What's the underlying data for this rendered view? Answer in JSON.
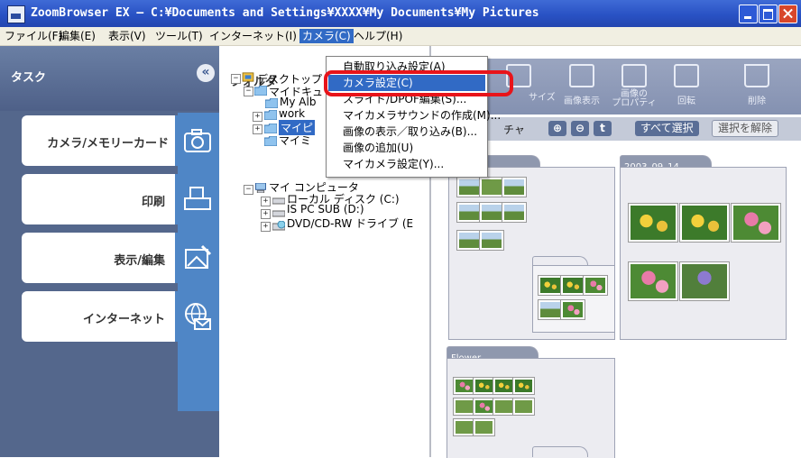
{
  "window": {
    "title": "ZoomBrowser EX  –  C:¥Documents and Settings¥XXXX¥My Documents¥My Pictures"
  },
  "menubar": {
    "items": [
      "ファイル(F)",
      "編集(E)",
      "表示(V)",
      "ツール(T)",
      "インターネット(I)",
      "カメラ(C)",
      "ヘルプ(H)"
    ],
    "active_index": 5
  },
  "taskpane": {
    "header": "タスク",
    "collapse_glyph": "«",
    "tasks": [
      {
        "label": "カメラ/メモリーカード",
        "icon": "camera-icon"
      },
      {
        "label": "印刷",
        "icon": "printer-icon"
      },
      {
        "label": "表示/編集",
        "icon": "edit-image-icon"
      },
      {
        "label": "インターネット",
        "icon": "globe-mail-icon"
      }
    ]
  },
  "folder_tree": {
    "header": "フォルダ",
    "nodes": [
      {
        "label": "デスクトップ",
        "expander": "−"
      },
      {
        "label": "マイドキュ",
        "expander": "−"
      },
      {
        "label": "My Alb",
        "expander": ""
      },
      {
        "label": "work",
        "expander": "+"
      },
      {
        "label": "マイピ",
        "expander": "+",
        "selected": true
      },
      {
        "label": "マイミ",
        "expander": ""
      },
      {
        "label": "マイ コンピュータ",
        "expander": "−"
      },
      {
        "label": "ローカル ディスク (C:)",
        "expander": "+"
      },
      {
        "label": "IS PC SUB (D:)",
        "expander": "+"
      },
      {
        "label": "DVD/CD-RW ドライブ (E",
        "expander": "+"
      }
    ]
  },
  "camera_menu": {
    "items": [
      "自動取り込み設定(A)",
      "カメラ設定(C)",
      "スライド/DPOF編集(S)...",
      "マイカメラサウンドの作成(M)...",
      "画像の表示／取り込み(B)...",
      "画像の追加(U)",
      "マイカメラ設定(Y)..."
    ],
    "highlighted_index": 1
  },
  "toolbar": {
    "buttons": [
      {
        "caption": "",
        "icon": "share-icon"
      },
      {
        "caption": "サイズ",
        "icon": "resize-icon"
      },
      {
        "caption": "画像表示",
        "icon": "view-image-icon"
      },
      {
        "caption": "画像の\nプロパティ",
        "icon": "properties-icon"
      },
      {
        "caption": "回転",
        "icon": "rotate-icon"
      },
      {
        "caption": "削除",
        "icon": "trash-icon"
      }
    ]
  },
  "selection_bar": {
    "left_text": "チャ",
    "zoom_in": "⊕",
    "zoom_out": "⊖",
    "up": "t",
    "select_all": "すべて選択",
    "deselect": "選択を解除"
  },
  "folders": [
    {
      "name": ""
    },
    {
      "name": "2003_09_14"
    },
    {
      "name": ""
    },
    {
      "name": "Flower"
    },
    {
      "name": ""
    }
  ],
  "colors": {
    "accent": "#316ac5",
    "highlight_ring": "#e8141a",
    "taskpane": "#54678c",
    "task_icon_bg": "#4f86c6"
  }
}
